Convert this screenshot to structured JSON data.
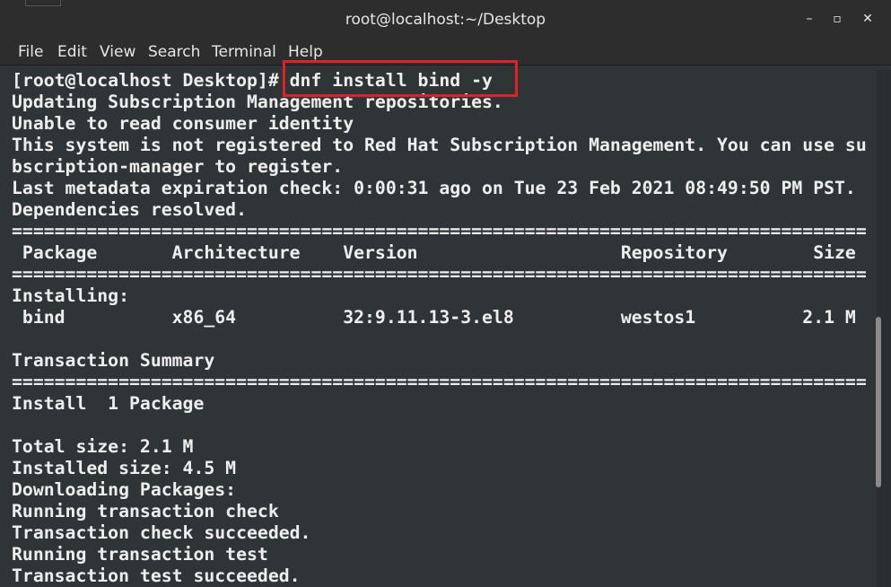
{
  "window": {
    "title": "root@localhost:~/Desktop",
    "controls": {
      "minimize": "–",
      "maximize": "▫",
      "close": "✕"
    }
  },
  "menu": [
    "File",
    "Edit",
    "View",
    "Search",
    "Terminal",
    "Help"
  ],
  "terminal": {
    "lines": [
      "[root@localhost Desktop]# dnf install bind -y",
      "Updating Subscription Management repositories.",
      "Unable to read consumer identity",
      "This system is not registered to Red Hat Subscription Management. You can use su",
      "bscription-manager to register.",
      "Last metadata expiration check: 0:00:31 ago on Tue 23 Feb 2021 08:49:50 PM PST.",
      "Dependencies resolved.",
      "================================================================================",
      " Package       Architecture    Version                   Repository        Size",
      "================================================================================",
      "Installing:",
      " bind          x86_64          32:9.11.13-3.el8          westos1          2.1 M",
      "",
      "Transaction Summary",
      "================================================================================",
      "Install  1 Package",
      "",
      "Total size: 2.1 M",
      "Installed size: 4.5 M",
      "Downloading Packages:",
      "Running transaction check",
      "Transaction check succeeded.",
      "Running transaction test",
      "Transaction test succeeded."
    ]
  },
  "colors": {
    "terminal_bg": "#2f3436",
    "terminal_fg": "#eeeeec",
    "titlebar_bg": "#2d2d2d",
    "highlight_border": "#e0202a"
  }
}
